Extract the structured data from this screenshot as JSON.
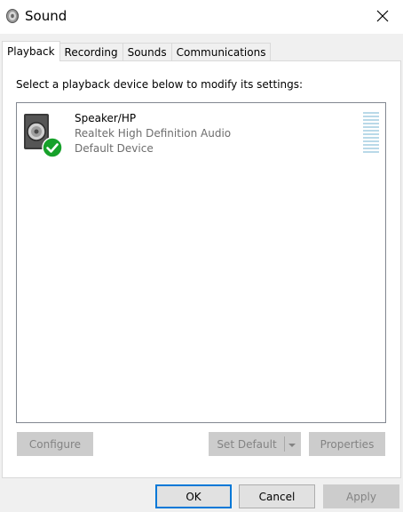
{
  "window": {
    "title": "Sound",
    "icon": "speaker-icon"
  },
  "tabs": [
    {
      "label": "Playback",
      "active": true
    },
    {
      "label": "Recording",
      "active": false
    },
    {
      "label": "Sounds",
      "active": false
    },
    {
      "label": "Communications",
      "active": false
    }
  ],
  "playback": {
    "instruction": "Select a playback device below to modify its settings:",
    "devices": [
      {
        "name": "Speaker/HP",
        "driver": "Realtek High Definition Audio",
        "status": "Default Device",
        "icon": "speaker-icon",
        "status_icon": "checkmark-icon",
        "level": 0
      }
    ],
    "buttons": {
      "configure": "Configure",
      "set_default": "Set Default",
      "properties": "Properties"
    }
  },
  "dialog_buttons": {
    "ok": "OK",
    "cancel": "Cancel",
    "apply": "Apply"
  },
  "colors": {
    "accent": "#0078d7",
    "check_green": "#16a12a",
    "meter": "#b9d9e8",
    "disabled_bg": "#cccccc",
    "disabled_text": "#838383"
  }
}
